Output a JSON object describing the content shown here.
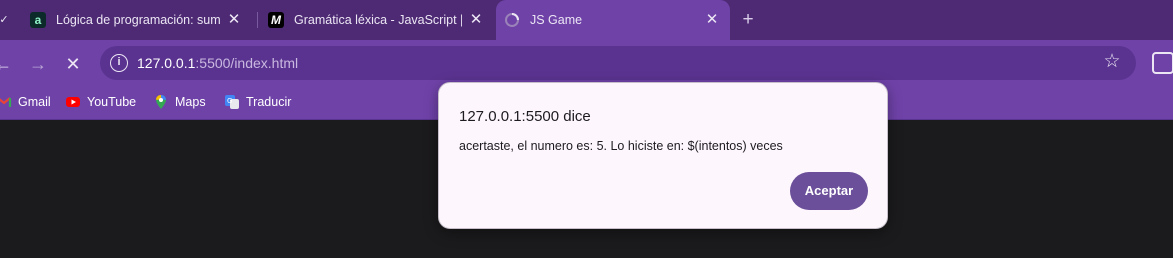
{
  "tabs": [
    {
      "title": "Lógica de programación: sumér",
      "favicon": "alura-icon",
      "active": false
    },
    {
      "title": "Gramática léxica - JavaScript | M",
      "favicon": "mdn-icon",
      "active": false
    },
    {
      "title": "JS Game",
      "favicon": "loading-spinner-icon",
      "active": true
    }
  ],
  "toolbar": {
    "url_host": "127.0.0.1",
    "url_rest": ":5500/index.html"
  },
  "bookmarks": [
    {
      "label": "Gmail",
      "icon": "gmail-icon"
    },
    {
      "label": "YouTube",
      "icon": "youtube-icon"
    },
    {
      "label": "Maps",
      "icon": "maps-icon"
    },
    {
      "label": "Traducir",
      "icon": "translate-icon"
    }
  ],
  "dialog": {
    "title": "127.0.0.1:5500 dice",
    "message": "acertaste, el numero es: 5. Lo hiciste en: $(intentos) veces",
    "ok_label": "Aceptar"
  },
  "colors": {
    "tabstrip": "#4d2a73",
    "toolbar": "#6f42a8",
    "omnibox": "#5a3390",
    "page_bg": "#1b1a1c",
    "dialog_bg": "#fdf7fd",
    "dialog_button": "#6b4f9a"
  }
}
